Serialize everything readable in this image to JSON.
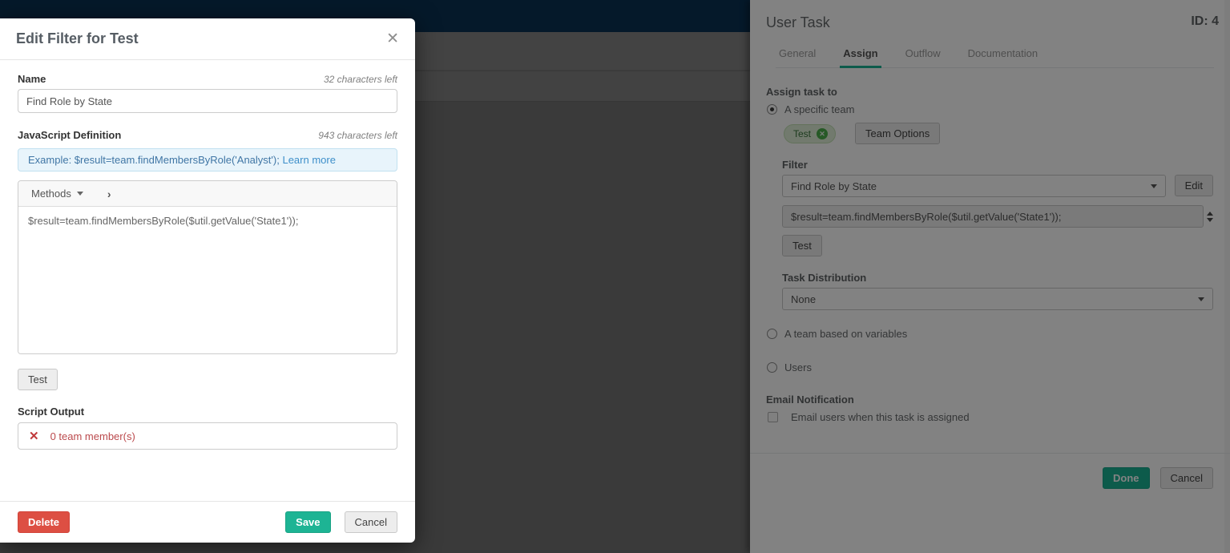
{
  "colors": {
    "accent_teal": "#1ab394",
    "danger_red": "#dd4f43",
    "error_red": "#bb4a4d",
    "info_blue_bg": "#e8f4fb",
    "info_blue_text": "#4076a5",
    "tag_green_bg": "#dff0d8",
    "tag_badge_green": "#4cae4c",
    "topbar_navy": "#05192a"
  },
  "modal": {
    "title": "Edit Filter for Test",
    "close_icon": "✕",
    "name": {
      "label": "Name",
      "counter": "32 characters left",
      "value": "Find Role by State"
    },
    "js": {
      "label": "JavaScript Definition",
      "counter": "943 characters left"
    },
    "example": {
      "text": "Example: $result=team.findMembersByRole('Analyst');",
      "link": "Learn more"
    },
    "editor": {
      "methods_label": "Methods",
      "chevron": "›",
      "code": "$result=team.findMembersByRole($util.getValue('State1'));"
    },
    "test_button": "Test",
    "script_output": {
      "label": "Script Output",
      "value": "0 team member(s)",
      "error_icon": "✕"
    },
    "delete_button": "Delete",
    "save_button": "Save",
    "cancel_button": "Cancel"
  },
  "panel": {
    "title": "User Task",
    "id": "ID: 4",
    "tabs": [
      {
        "label": "General"
      },
      {
        "label": "Assign"
      },
      {
        "label": "Outflow"
      },
      {
        "label": "Documentation"
      }
    ],
    "assign_to_label": "Assign task to",
    "radio_specific_team": "A specific team",
    "team_tag": {
      "label": "Test",
      "remove_icon": "✕"
    },
    "team_options_button": "Team Options",
    "filter": {
      "label": "Filter",
      "selected": "Find Role by State",
      "edit_button": "Edit",
      "script": "$result=team.findMembersByRole($util.getValue('State1'));",
      "test_button": "Test"
    },
    "task_distribution": {
      "label": "Task Distribution",
      "selected": "None"
    },
    "radio_variables": "A team based on variables",
    "radio_users": "Users",
    "email": {
      "label": "Email Notification",
      "checkbox_label": "Email users when this task is assigned"
    },
    "done_button": "Done",
    "cancel_button": "Cancel"
  }
}
